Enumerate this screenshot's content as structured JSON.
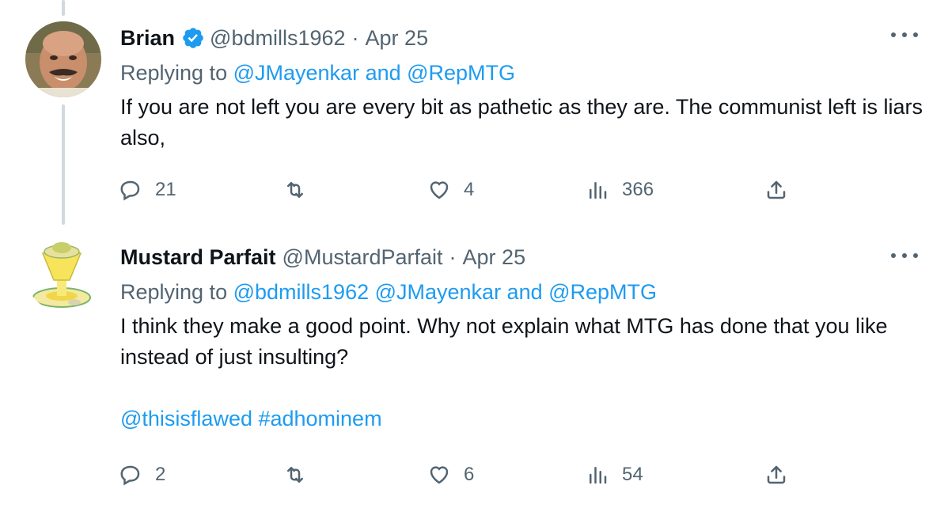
{
  "tweets": [
    {
      "name": "Brian",
      "handle": "@bdmills1962",
      "date": "Apr 25",
      "replying_prefix": "Replying to",
      "replying_links": "@JMayenkar and @RepMTG",
      "text": "If you are not left you are every bit as pathetic as they are. The communist left is liars also,",
      "tags": "",
      "replies": "21",
      "retweets": "",
      "likes": "4",
      "views": "366",
      "verified": true
    },
    {
      "name": "Mustard Parfait",
      "handle": "@MustardParfait",
      "date": "Apr 25",
      "replying_prefix": "Replying to",
      "replying_links": "@bdmills1962 @JMayenkar and @RepMTG",
      "text": "I think they make a good point. Why not explain what MTG has done that you like instead of just insulting?",
      "tags": "@thisisflawed #adhominem",
      "replies": "2",
      "retweets": "",
      "likes": "6",
      "views": "54",
      "verified": false
    }
  ],
  "separator_dot": "·",
  "colors": {
    "text": "#0f1419",
    "secondary": "#536471",
    "link": "#1d9bf0",
    "thread_line": "#cfd9de",
    "verified_badge": "#1d9bf0"
  },
  "icons": [
    "reply-icon",
    "retweet-icon",
    "like-icon",
    "views-icon",
    "share-icon",
    "more-icon",
    "verified-badge-icon"
  ]
}
